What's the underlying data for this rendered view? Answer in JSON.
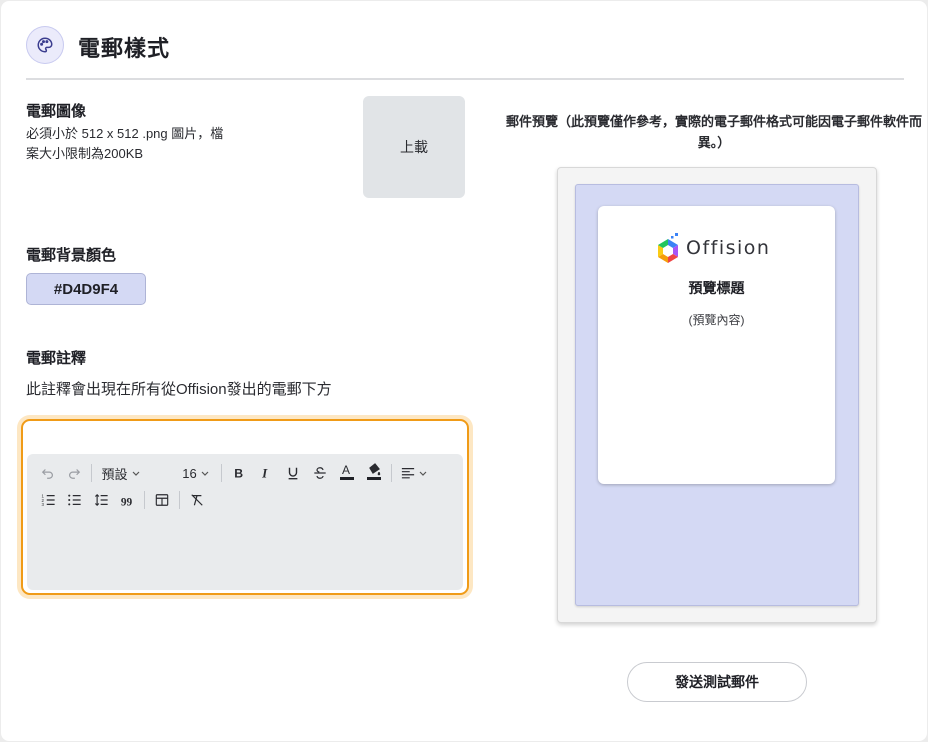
{
  "header": {
    "title": "電郵樣式",
    "icon": "palette-icon"
  },
  "image_section": {
    "title": "電郵圖像",
    "desc_line1": "必須小於 512 x 512 .png 圖片，檔",
    "desc_line2": "案大小限制為200KB",
    "upload_label": "上載"
  },
  "bg_section": {
    "title": "電郵背景顏色",
    "color_value": "#D4D9F4"
  },
  "note_section": {
    "title": "電郵註釋",
    "desc": "此註釋會出現在所有從Offision發出的電郵下方",
    "editor": {
      "block_format": "預設",
      "font_size": "16",
      "content": ""
    }
  },
  "preview": {
    "caption": "郵件預覽（此預覽僅作參考，實際的電子郵件格式可能因電子郵件軟件而異。）",
    "logo_text": "Offision",
    "title": "預覽標題",
    "body": "(預覽內容)",
    "background_color": "#D4D9F4"
  },
  "actions": {
    "test_email_label": "發送測試郵件"
  },
  "colors": {
    "accent": "#f09b17",
    "panel": "#e9ebed"
  }
}
